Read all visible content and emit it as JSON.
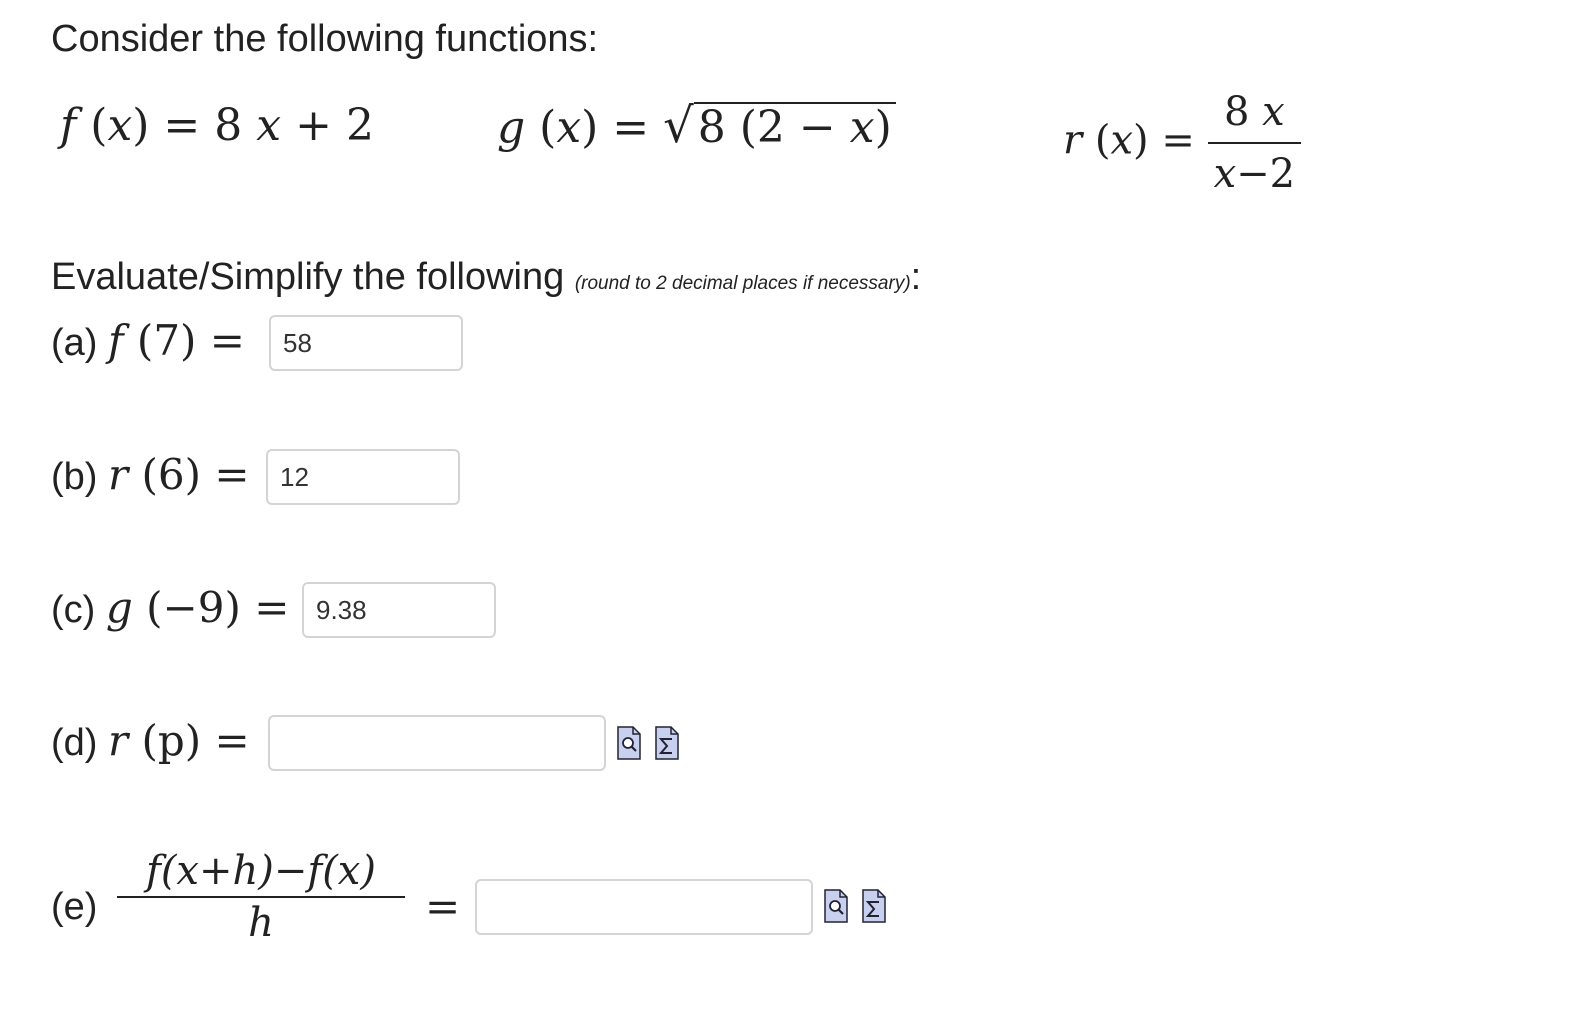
{
  "intro": "Consider the following functions:",
  "functions": {
    "f": {
      "lhs": "f",
      "var": "x",
      "rhs_coef": "8",
      "rhs_var": "x",
      "rhs_op": "+",
      "rhs_const": "2"
    },
    "g": {
      "lhs": "g",
      "var": "x",
      "radicand_coef": "8",
      "radicand_a": "2",
      "radicand_op": "−",
      "radicand_var": "x"
    },
    "r": {
      "lhs": "r",
      "var": "x",
      "num_coef": "8",
      "num_var": "x",
      "den_var": "x",
      "den_op": "−",
      "den_const": "2"
    }
  },
  "instructions": {
    "main": "Evaluate/Simplify the following",
    "note": "(round to 2 decimal places if necessary)",
    "colon": ":"
  },
  "questions": {
    "a": {
      "label": "(a)",
      "fn": "f",
      "arg": "7",
      "value": "58"
    },
    "b": {
      "label": "(b)",
      "fn": "r",
      "arg": "6",
      "value": "12"
    },
    "c": {
      "label": "(c)",
      "fn": "g",
      "arg": "−9",
      "value": "9.38"
    },
    "d": {
      "label": "(d)",
      "fn": "r",
      "arg": "p",
      "value": ""
    },
    "e": {
      "label": "(e)",
      "num": "f(x+h)−f(x)",
      "den": "h",
      "value": ""
    }
  },
  "equals": "=",
  "icons": [
    "preview-icon",
    "equation-editor-icon"
  ]
}
